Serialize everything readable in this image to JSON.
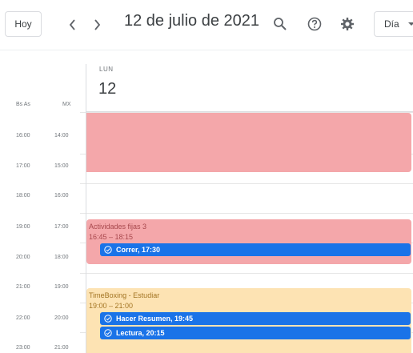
{
  "toolbar": {
    "today_label": "Hoy",
    "prev_icon": "chevron-left-icon",
    "next_icon": "chevron-right-icon",
    "date_title": "12 de julio de 2021",
    "search_icon": "search-icon",
    "help_icon": "help-icon",
    "settings_icon": "gear-icon",
    "view_label": "Día"
  },
  "day_header": {
    "weekday": "LUN",
    "day_number": "12"
  },
  "timezones": {
    "primary": "Bs As",
    "secondary": "MX"
  },
  "hours": [
    {
      "primary": "16:00",
      "secondary": "14:00"
    },
    {
      "primary": "17:00",
      "secondary": "15:00"
    },
    {
      "primary": "18:00",
      "secondary": "16:00"
    },
    {
      "primary": "19:00",
      "secondary": "17:00"
    },
    {
      "primary": "20:00",
      "secondary": "18:00"
    },
    {
      "primary": "21:00",
      "secondary": "19:00"
    },
    {
      "primary": "22:00",
      "secondary": "20:00"
    },
    {
      "primary": "23:00",
      "secondary": "21:00"
    }
  ],
  "events": [
    {
      "title": "",
      "time": "",
      "color": "#f4a7aa"
    },
    {
      "title": "Actividades fijas 3",
      "time": "16:45 – 18:15",
      "color": "#f4a7aa"
    },
    {
      "title": "TimeBoxing - Estudiar",
      "time": "19:00 – 21:00",
      "color": "#fde3b3"
    }
  ],
  "tasks": [
    {
      "label": "Correr, 17:30",
      "color": "#1a73e8"
    },
    {
      "label": "Hacer Resumen, 19:45",
      "color": "#1a73e8"
    },
    {
      "label": "Lectura, 20:15",
      "color": "#1a73e8"
    }
  ]
}
